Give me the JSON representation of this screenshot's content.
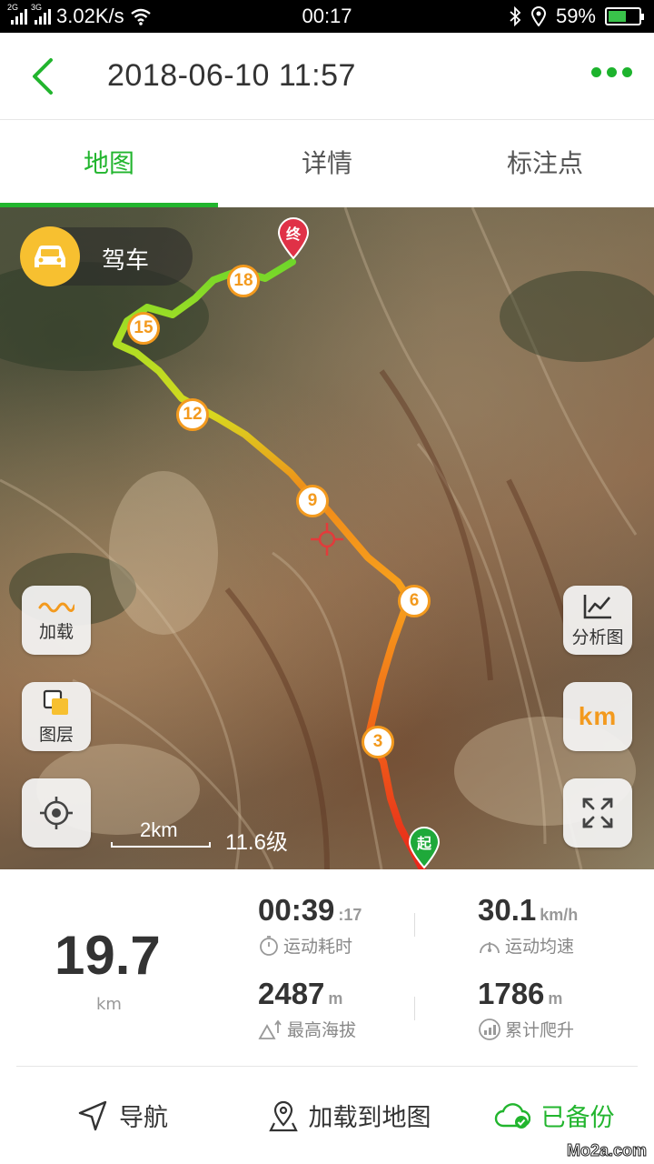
{
  "status_bar": {
    "network_a": "2G",
    "network_b": "3G",
    "speed": "3.02K/s",
    "time": "00:17",
    "battery": "59%",
    "battery_level": 0.59,
    "icons": [
      "signal-icon",
      "wifi-icon",
      "bluetooth-icon",
      "location-icon",
      "battery-charging-icon"
    ]
  },
  "header": {
    "title": "2018-06-10 11:57",
    "accent_color": "#22b52e"
  },
  "tabs": [
    {
      "label": "地图",
      "active": true
    },
    {
      "label": "详情",
      "active": false
    },
    {
      "label": "标注点",
      "active": false
    }
  ],
  "map": {
    "mode_label": "驾车",
    "start_label": "起",
    "end_label": "终",
    "km_markers": [
      "3",
      "6",
      "9",
      "12",
      "15",
      "18"
    ],
    "left_buttons": [
      {
        "label": "加载",
        "icon": "wave-icon"
      },
      {
        "label": "图层",
        "icon": "layers-icon"
      },
      {
        "label": "",
        "icon": "locate-icon"
      }
    ],
    "right_buttons": [
      {
        "label": "分析图",
        "icon": "chart-icon"
      },
      {
        "label": "km",
        "icon": "km-icon"
      },
      {
        "label": "",
        "icon": "fullscreen-icon"
      }
    ],
    "scale_text": "2km",
    "zoom_text": "11.6级"
  },
  "stats": {
    "distance": "19.7",
    "distance_unit": "km",
    "duration": "00:39",
    "duration_sec": ":17",
    "duration_label": "运动耗时",
    "avg_speed": "30.1",
    "avg_speed_unit": "km/h",
    "avg_speed_label": "运动均速",
    "max_alt": "2487",
    "max_alt_unit": "m",
    "max_alt_label": "最高海拔",
    "climb": "1786",
    "climb_unit": "m",
    "climb_label": "累计爬升"
  },
  "actions": [
    {
      "label": "导航",
      "icon": "navigation-icon"
    },
    {
      "label": "加载到地图",
      "icon": "map-pin-icon"
    },
    {
      "label": "已备份",
      "icon": "cloud-check-icon"
    }
  ],
  "watermark": "Mo2a.com"
}
